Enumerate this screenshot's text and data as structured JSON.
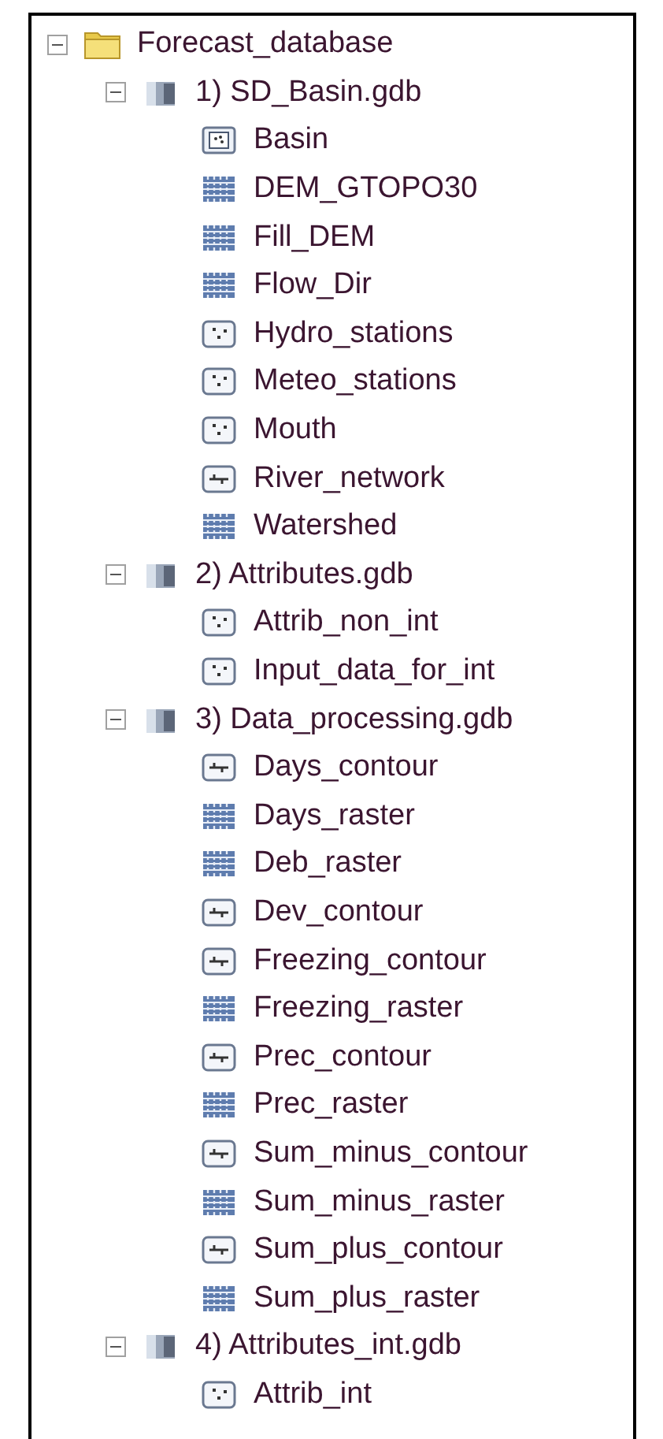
{
  "tree": [
    {
      "label": "Forecast_database",
      "kind": "folder",
      "expanded": true,
      "children": [
        {
          "label": "1) SD_Basin.gdb",
          "kind": "gdb",
          "expanded": true,
          "children": [
            {
              "label": "Basin",
              "kind": "polygon"
            },
            {
              "label": "DEM_GTOPO30",
              "kind": "raster"
            },
            {
              "label": "Fill_DEM",
              "kind": "raster"
            },
            {
              "label": "Flow_Dir",
              "kind": "raster"
            },
            {
              "label": "Hydro_stations",
              "kind": "point"
            },
            {
              "label": "Meteo_stations",
              "kind": "point"
            },
            {
              "label": "Mouth",
              "kind": "point"
            },
            {
              "label": "River_network",
              "kind": "line"
            },
            {
              "label": "Watershed",
              "kind": "raster"
            }
          ]
        },
        {
          "label": "2) Attributes.gdb",
          "kind": "gdb",
          "expanded": true,
          "children": [
            {
              "label": "Attrib_non_int",
              "kind": "point"
            },
            {
              "label": "Input_data_for_int",
              "kind": "point"
            }
          ]
        },
        {
          "label": "3) Data_processing.gdb",
          "kind": "gdb",
          "expanded": true,
          "children": [
            {
              "label": "Days_contour",
              "kind": "line"
            },
            {
              "label": "Days_raster",
              "kind": "raster"
            },
            {
              "label": "Deb_raster",
              "kind": "raster"
            },
            {
              "label": "Dev_contour",
              "kind": "line"
            },
            {
              "label": "Freezing_contour",
              "kind": "line"
            },
            {
              "label": "Freezing_raster",
              "kind": "raster"
            },
            {
              "label": "Prec_contour",
              "kind": "line"
            },
            {
              "label": "Prec_raster",
              "kind": "raster"
            },
            {
              "label": "Sum_minus_contour",
              "kind": "line"
            },
            {
              "label": "Sum_minus_raster",
              "kind": "raster"
            },
            {
              "label": "Sum_plus_contour",
              "kind": "line"
            },
            {
              "label": "Sum_plus_raster",
              "kind": "raster"
            }
          ]
        },
        {
          "label": "4) Attributes_int.gdb",
          "kind": "gdb",
          "expanded": true,
          "children": [
            {
              "label": "Attrib_int",
              "kind": "point"
            }
          ]
        }
      ]
    }
  ]
}
